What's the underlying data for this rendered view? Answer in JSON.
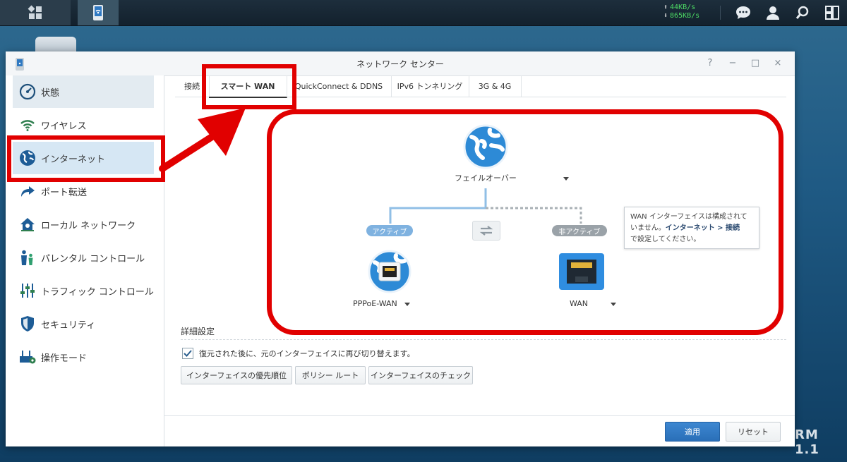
{
  "taskbar": {
    "upload_speed": "44KB/s",
    "download_speed": "865KB/s",
    "icons": [
      "main-menu-icon",
      "network-center-app-icon",
      "chat-icon",
      "user-icon",
      "search-icon",
      "widgets-icon"
    ]
  },
  "desktop": {
    "watermark": "RM 1.1"
  },
  "window": {
    "title": "ネットワーク センター",
    "controls": [
      "?",
      "−",
      "□",
      "×"
    ]
  },
  "sidebar": {
    "items": [
      {
        "label": "状態",
        "icon": "status-gauge-icon"
      },
      {
        "label": "ワイヤレス",
        "icon": "wifi-icon"
      },
      {
        "label": "インターネット",
        "icon": "globe-icon"
      },
      {
        "label": "ポート転送",
        "icon": "arrow-forward-icon"
      },
      {
        "label": "ローカル ネットワーク",
        "icon": "home-network-icon"
      },
      {
        "label": "パレンタル コントロール",
        "icon": "family-icon"
      },
      {
        "label": "トラフィック コントロール",
        "icon": "sliders-icon"
      },
      {
        "label": "セキュリティ",
        "icon": "shield-icon"
      },
      {
        "label": "操作モード",
        "icon": "router-gear-icon"
      }
    ]
  },
  "tabs": [
    "接続",
    "スマート WAN",
    "QuickConnect & DDNS",
    "IPv6 トンネリング",
    "3G & 4G"
  ],
  "diagram": {
    "mode_label": "フェイルオーバー",
    "active_pill": "アクティブ",
    "inactive_pill": "非アクティブ",
    "left_iface": "PPPoE-WAN",
    "right_iface": "WAN"
  },
  "tooltip": {
    "line1": "WAN インターフェイスは構成されて",
    "line2_pre": "いません。",
    "line2_link": "インターネット > 接続",
    "line3": "で設定してください。"
  },
  "advanced": {
    "title": "詳細設定",
    "checkbox_label": "復元された後に、元のインターフェイスに再び切り替えます。",
    "checkbox_checked": true,
    "buttons": [
      "インターフェイスの優先順位",
      "ポリシー ルート",
      "インターフェイスのチェック"
    ]
  },
  "footer": {
    "apply": "適用",
    "reset": "リセット"
  },
  "colors": {
    "annotation_red": "#e10000",
    "active_blue": "#7fb2e0",
    "inactive_gray": "#9aa2a8"
  }
}
